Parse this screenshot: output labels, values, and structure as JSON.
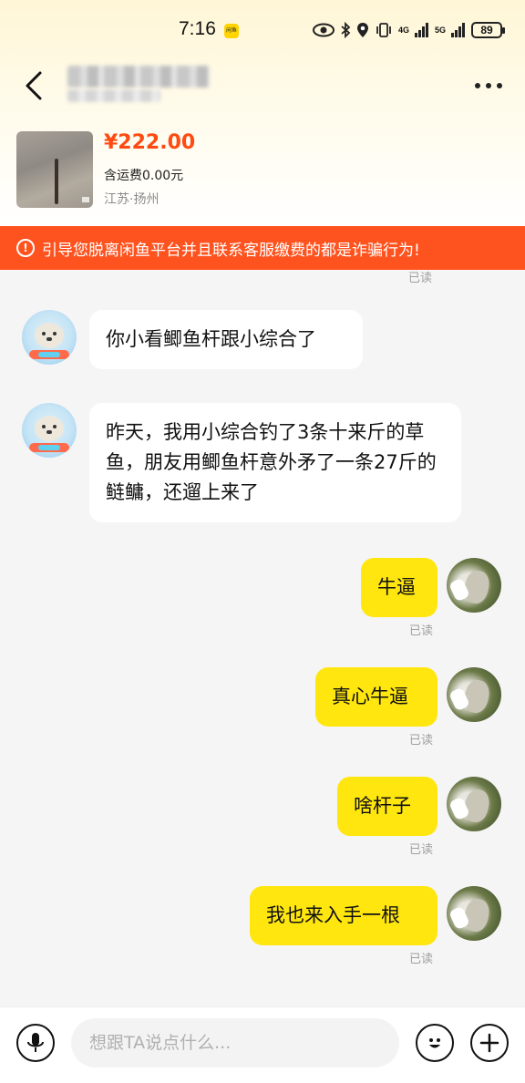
{
  "status_bar": {
    "time": "7:16",
    "app_badge": "闲鱼",
    "network_1": "4G",
    "network_2": "5G",
    "battery": "89"
  },
  "product": {
    "price": "¥222.00",
    "shipping": "含运费0.00元",
    "location": "江苏·扬州"
  },
  "warning": {
    "text": "引导您脱离闲鱼平台并且联系客服缴费的都是诈骗行为!"
  },
  "top_read": "已读",
  "messages": [
    {
      "side": "in",
      "text": "你小看鲫鱼杆跟小综合了"
    },
    {
      "side": "in",
      "text": "昨天，我用小综合钓了3条十来斤的草鱼，朋友用鲫鱼杆意外矛了一条27斤的鲢鳙，还遛上来了"
    },
    {
      "side": "out",
      "text": "牛逼",
      "status": "已读"
    },
    {
      "side": "out",
      "text": "真心牛逼",
      "status": "已读"
    },
    {
      "side": "out",
      "text": "啥杆子",
      "status": "已读"
    },
    {
      "side": "out",
      "text": "我也来入手一根",
      "status": "已读"
    }
  ],
  "input": {
    "placeholder": "想跟TA说点什么..."
  },
  "icons": {
    "back": "back-chevron-icon",
    "more": "more-dots-icon",
    "voice": "microphone-icon",
    "emoji": "emoji-icon",
    "plus": "plus-icon",
    "warning": "alert-circle-icon"
  },
  "colors": {
    "accent_yellow": "#ffe60f",
    "warning_orange": "#ff531f",
    "price_red": "#ff4a12"
  }
}
